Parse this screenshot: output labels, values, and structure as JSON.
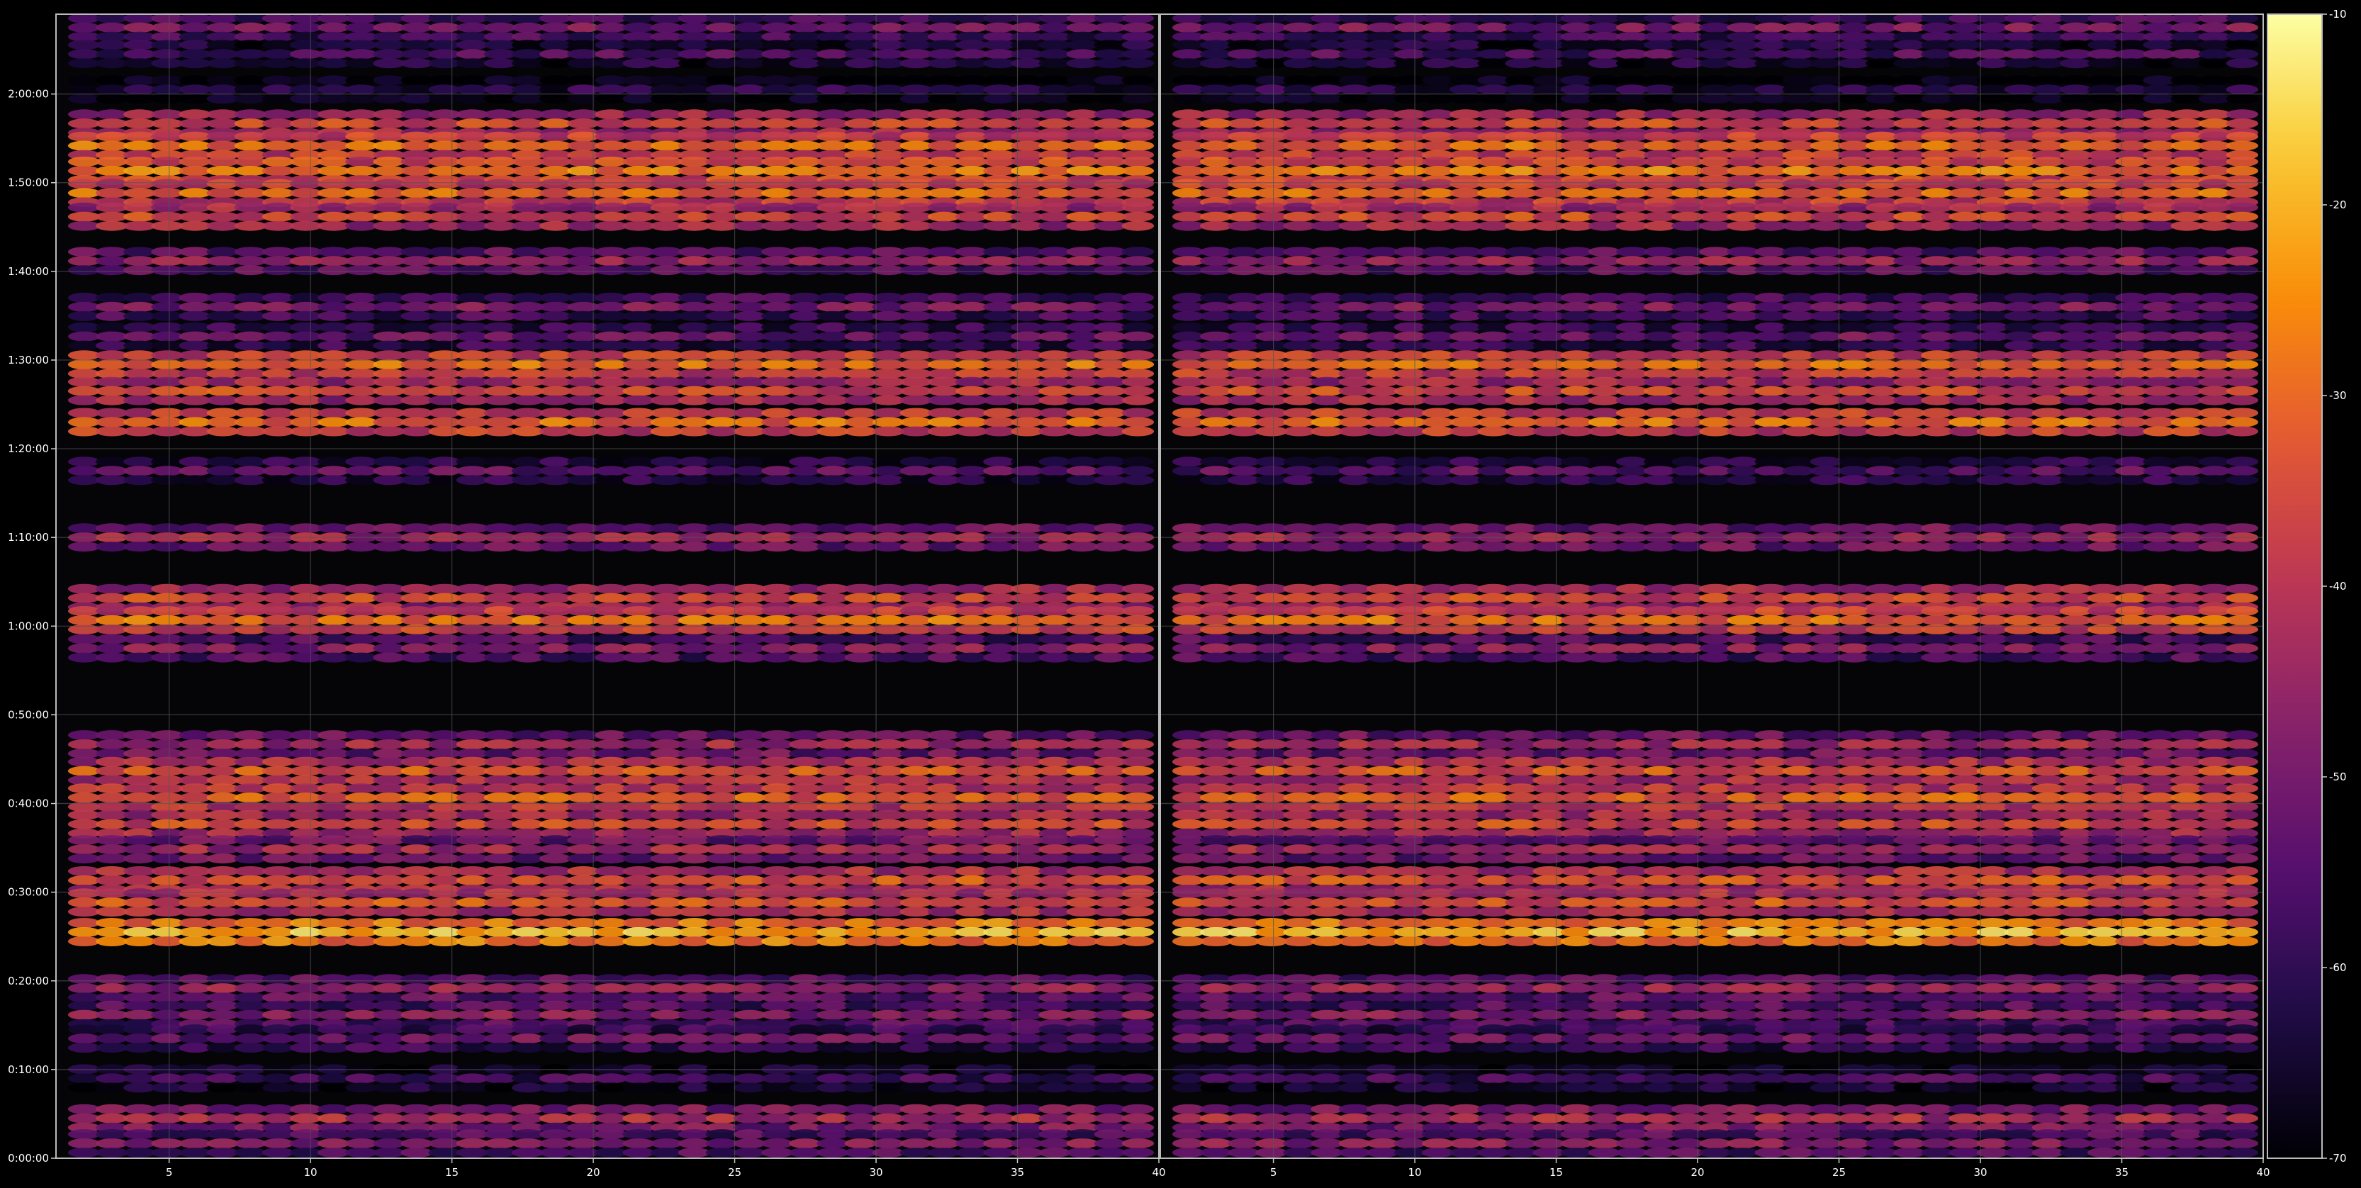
{
  "chart_data": {
    "type": "heatmap",
    "title": "",
    "xlabel": "",
    "ylabel": "",
    "grid": true,
    "colormap": "inferno",
    "colors": {
      "background": "#000000",
      "axes": "#0a0a0a",
      "grid": "#555555",
      "text": "#ffffff"
    },
    "panels": [
      {
        "name": "left",
        "xlim": [
          1,
          40
        ],
        "xticks": [
          "5",
          "10",
          "15",
          "20",
          "25",
          "30",
          "35",
          "40"
        ],
        "xtick_values": [
          5,
          10,
          15,
          20,
          25,
          30,
          35,
          40
        ]
      },
      {
        "name": "right",
        "xlim": [
          1,
          40
        ],
        "xticks": [
          "5",
          "10",
          "15",
          "20",
          "25",
          "30",
          "35",
          "40"
        ],
        "xtick_values": [
          5,
          10,
          15,
          20,
          25,
          30,
          35,
          40
        ]
      }
    ],
    "ylim_seconds": [
      0,
      7740
    ],
    "yticks": [
      "0:00:00",
      "0:10:00",
      "0:20:00",
      "0:30:00",
      "0:40:00",
      "0:50:00",
      "1:00:00",
      "1:10:00",
      "1:20:00",
      "1:30:00",
      "1:40:00",
      "1:50:00",
      "2:00:00"
    ],
    "ytick_values": [
      0,
      600,
      1200,
      1800,
      2400,
      3000,
      3600,
      4200,
      4800,
      5400,
      6000,
      6600,
      7200
    ],
    "colorbar": {
      "range": [
        -70,
        -10
      ],
      "ticks": [
        "-10",
        "-20",
        "-30",
        "-40",
        "-50",
        "-60",
        "-70"
      ],
      "tick_values": [
        -10,
        -20,
        -30,
        -40,
        -50,
        -60,
        -70
      ]
    },
    "bands": [
      {
        "t": 7650,
        "level": -50
      },
      {
        "t": 7470,
        "level": -56
      },
      {
        "t": 7230,
        "level": -62
      },
      {
        "t": 7000,
        "level": -36
      },
      {
        "t": 6850,
        "level": -30
      },
      {
        "t": 6680,
        "level": -28
      },
      {
        "t": 6530,
        "level": -30
      },
      {
        "t": 6370,
        "level": -36
      },
      {
        "t": 6070,
        "level": -46
      },
      {
        "t": 5760,
        "level": -50
      },
      {
        "t": 5560,
        "level": -52
      },
      {
        "t": 5370,
        "level": -30
      },
      {
        "t": 5190,
        "level": -36
      },
      {
        "t": 4980,
        "level": -30
      },
      {
        "t": 4650,
        "level": -54
      },
      {
        "t": 4200,
        "level": -44
      },
      {
        "t": 3790,
        "level": -36
      },
      {
        "t": 3640,
        "level": -30
      },
      {
        "t": 3450,
        "level": -48
      },
      {
        "t": 2800,
        "level": -44
      },
      {
        "t": 2620,
        "level": -34
      },
      {
        "t": 2440,
        "level": -32
      },
      {
        "t": 2260,
        "level": -36
      },
      {
        "t": 2090,
        "level": -44
      },
      {
        "t": 1880,
        "level": -34
      },
      {
        "t": 1730,
        "level": -34
      },
      {
        "t": 1530,
        "level": -20
      },
      {
        "t": 1150,
        "level": -46
      },
      {
        "t": 970,
        "level": -48
      },
      {
        "t": 810,
        "level": -52
      },
      {
        "t": 540,
        "level": -58
      },
      {
        "t": 270,
        "level": -42
      },
      {
        "t": 100,
        "level": -48
      }
    ]
  }
}
